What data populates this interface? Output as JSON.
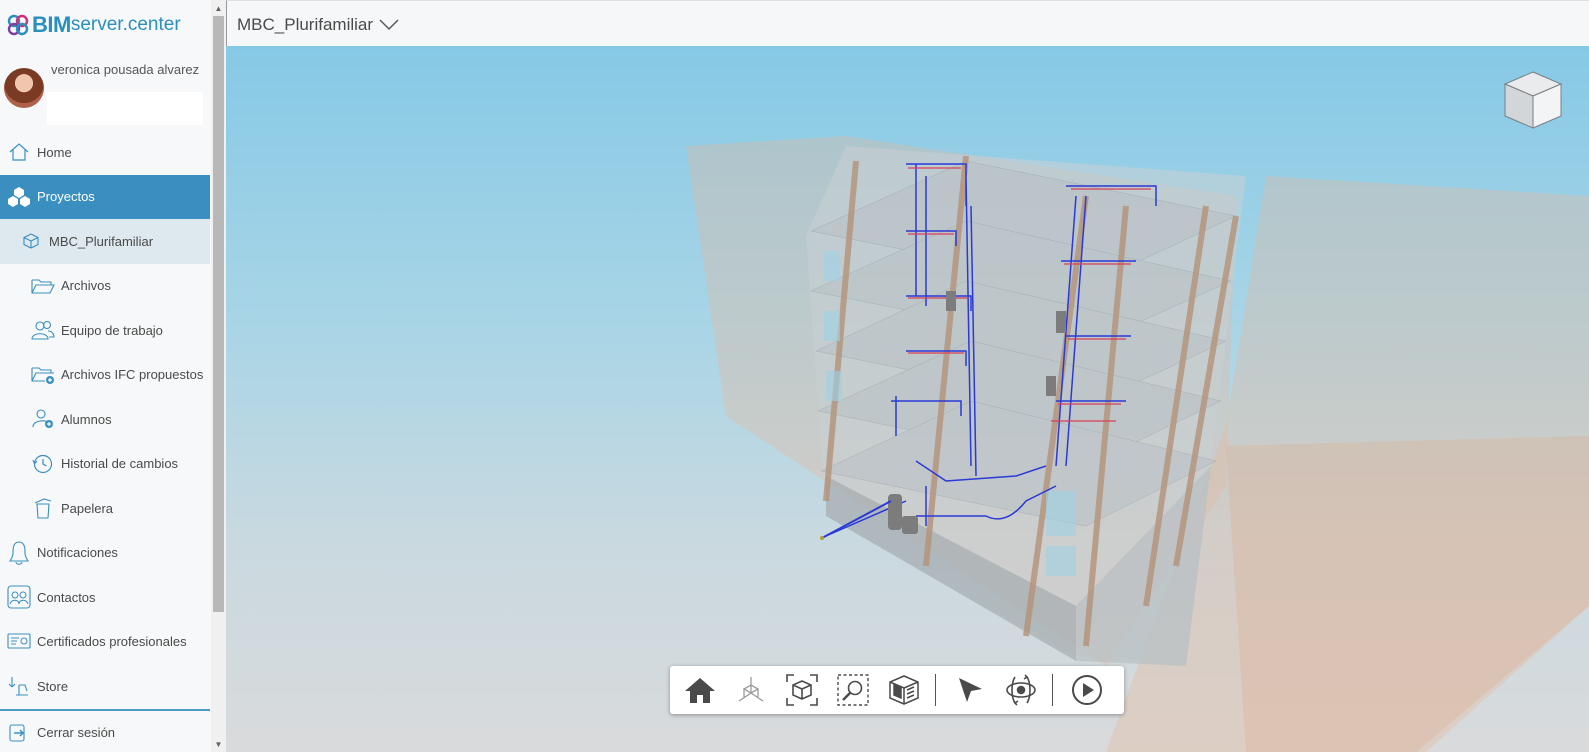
{
  "app": {
    "logo_bim": "BIM",
    "logo_rest": "server.center"
  },
  "user": {
    "name": "veronica pousada alvarez"
  },
  "sidebar": {
    "items": [
      {
        "label": "Home",
        "icon": "home-icon"
      },
      {
        "label": "Proyectos",
        "icon": "projects-icon"
      },
      {
        "label": "MBC_Plurifamiliar",
        "icon": "cube-icon"
      },
      {
        "label": "Archivos",
        "icon": "folder-icon"
      },
      {
        "label": "Equipo de trabajo",
        "icon": "team-icon"
      },
      {
        "label": "Archivos IFC propuestos",
        "icon": "folder-add-icon"
      },
      {
        "label": "Alumnos",
        "icon": "students-icon"
      },
      {
        "label": "Historial de cambios",
        "icon": "history-icon"
      },
      {
        "label": "Papelera",
        "icon": "trash-icon"
      },
      {
        "label": "Notificaciones",
        "icon": "bell-icon"
      },
      {
        "label": "Contactos",
        "icon": "contacts-icon"
      },
      {
        "label": "Certificados profesionales",
        "icon": "certificate-icon"
      },
      {
        "label": "Store",
        "icon": "store-icon"
      },
      {
        "label": "Cerrar sesión",
        "icon": "logout-icon"
      }
    ]
  },
  "header": {
    "project_title": "MBC_Plurifamiliar"
  },
  "viewer": {
    "toolbar": [
      "home-view-icon",
      "axes-icon",
      "fit-view-icon",
      "zoom-window-icon",
      "section-box-icon",
      "select-pointer-icon",
      "orbit-icon",
      "play-icon"
    ]
  },
  "colors": {
    "accent": "#3a8fc0",
    "accent_light": "#dde9ef",
    "brand": "#2a8fbd"
  }
}
